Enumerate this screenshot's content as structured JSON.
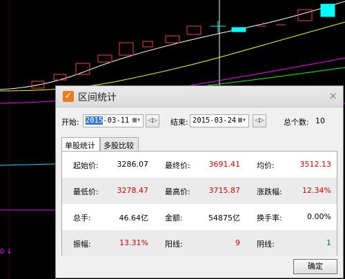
{
  "colors": {
    "candle_up": "#ff3a3a",
    "candle_flat": "#00ffff",
    "ma1": "#ffffff",
    "ma2": "#ffff00",
    "ma3": "#ff00ff",
    "ma4": "#00ff00",
    "ma5": "#00e0ff",
    "grid": "#7a0000",
    "accent": "#f07a1e",
    "negative": "#008000",
    "positive": "#d80000"
  },
  "chart": {
    "left_marker": "0"
  },
  "dialog": {
    "title": "区间统计",
    "close_icon": "×",
    "start_label": "开始:",
    "start_date_highlight": "2015",
    "start_date_rest": "-03-11",
    "end_label": "结束:",
    "end_date": "2015-03-24",
    "total_label": "总个数:",
    "total_value": "10",
    "tabs": [
      {
        "label": "单股统计"
      },
      {
        "label": "多股比较"
      }
    ],
    "ok_label": "确定",
    "stats": [
      [
        {
          "k": "起始价:",
          "v": "3286.07"
        },
        {
          "k": "最终价:",
          "v": "3691.41"
        },
        {
          "k": "均价:",
          "v": "3512.13"
        }
      ],
      [
        {
          "k": "最低价:",
          "v": "3278.47"
        },
        {
          "k": "最高价:",
          "v": "3715.87"
        },
        {
          "k": "涨跌幅:",
          "v": "12.34%"
        }
      ],
      [
        {
          "k": "总手:",
          "v": "46.64亿"
        },
        {
          "k": "金额:",
          "v": "54875亿"
        },
        {
          "k": "换手率:",
          "v": "0.00%"
        }
      ],
      [
        {
          "k": "振幅:",
          "v": "13.31%"
        },
        {
          "k": "阳线:",
          "v": "9"
        },
        {
          "k": "阴线:",
          "v": "1"
        }
      ]
    ]
  }
}
